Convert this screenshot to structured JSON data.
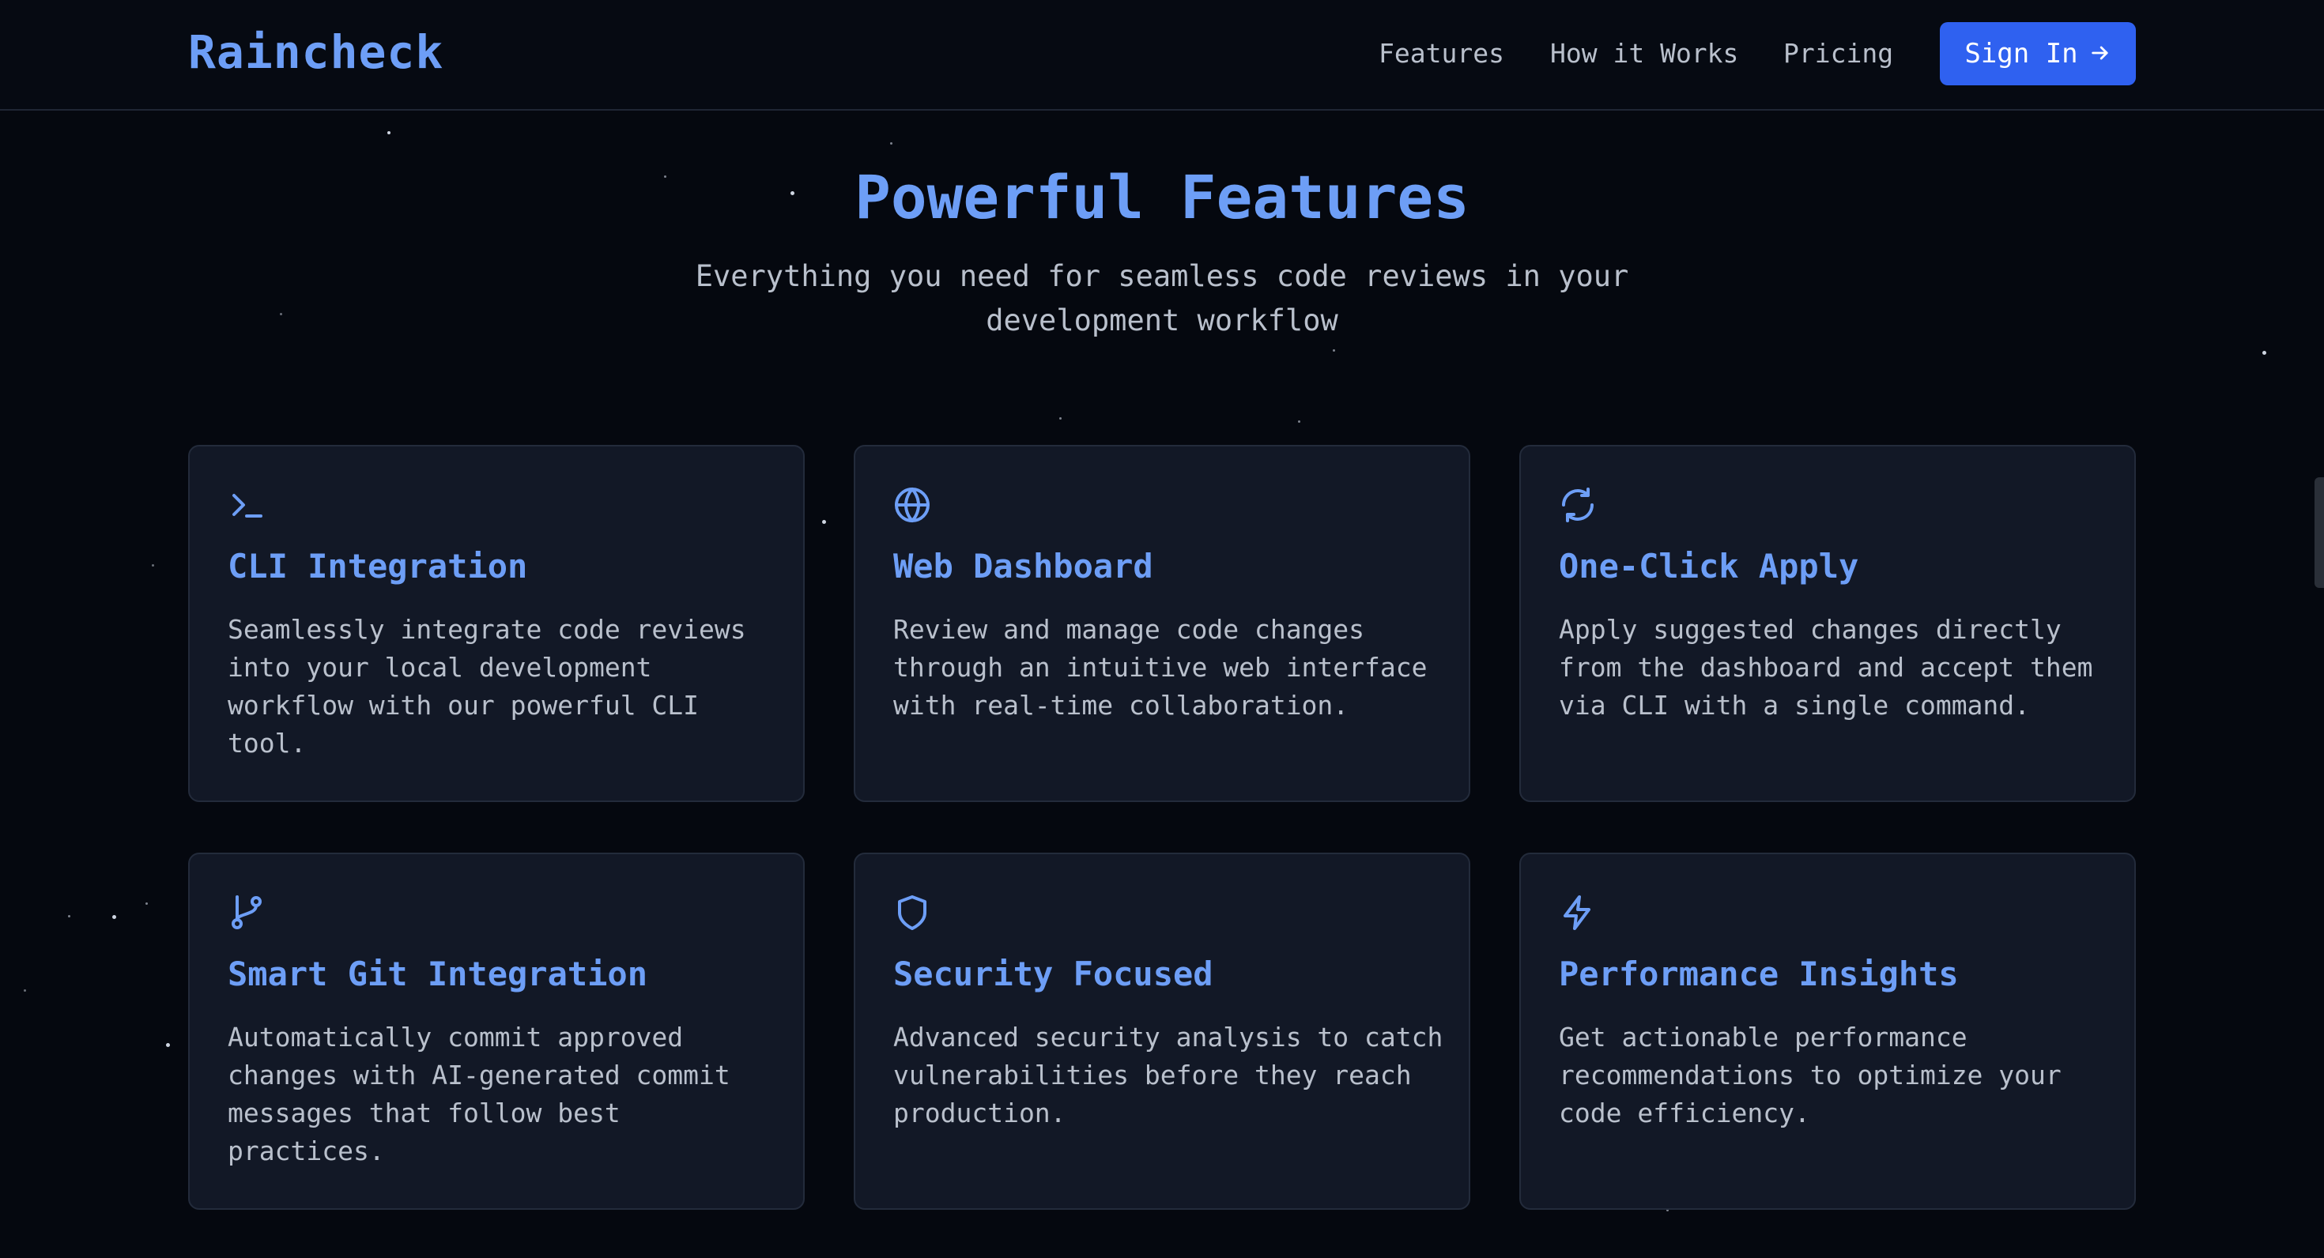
{
  "header": {
    "logo": "Raincheck",
    "nav": [
      {
        "label": "Features"
      },
      {
        "label": "How it Works"
      },
      {
        "label": "Pricing"
      }
    ],
    "signin_label": "Sign In"
  },
  "features_section": {
    "title": "Powerful Features",
    "subtitle": "Everything you need for seamless code reviews in your development workflow",
    "cards": [
      {
        "icon": "terminal-icon",
        "title": "CLI Integration",
        "description": "Seamlessly integrate code reviews into your local development workflow with our powerful CLI tool."
      },
      {
        "icon": "globe-icon",
        "title": "Web Dashboard",
        "description": "Review and manage code changes through an intuitive web interface with real-time collaboration."
      },
      {
        "icon": "refresh-icon",
        "title": "One-Click Apply",
        "description": "Apply suggested changes directly from the dashboard and accept them via CLI with a single command."
      },
      {
        "icon": "git-branch-icon",
        "title": "Smart Git Integration",
        "description": "Automatically commit approved changes with AI-generated commit messages that follow best practices."
      },
      {
        "icon": "shield-icon",
        "title": "Security Focused",
        "description": "Advanced security analysis to catch vulnerabilities before they reach production."
      },
      {
        "icon": "lightning-icon",
        "title": "Performance Insights",
        "description": "Get actionable performance recommendations to optimize your code efficiency."
      }
    ]
  },
  "colors": {
    "background": "#05080f",
    "card": "#121826",
    "accent": "#6d9ef6",
    "button": "#2f61f0"
  }
}
